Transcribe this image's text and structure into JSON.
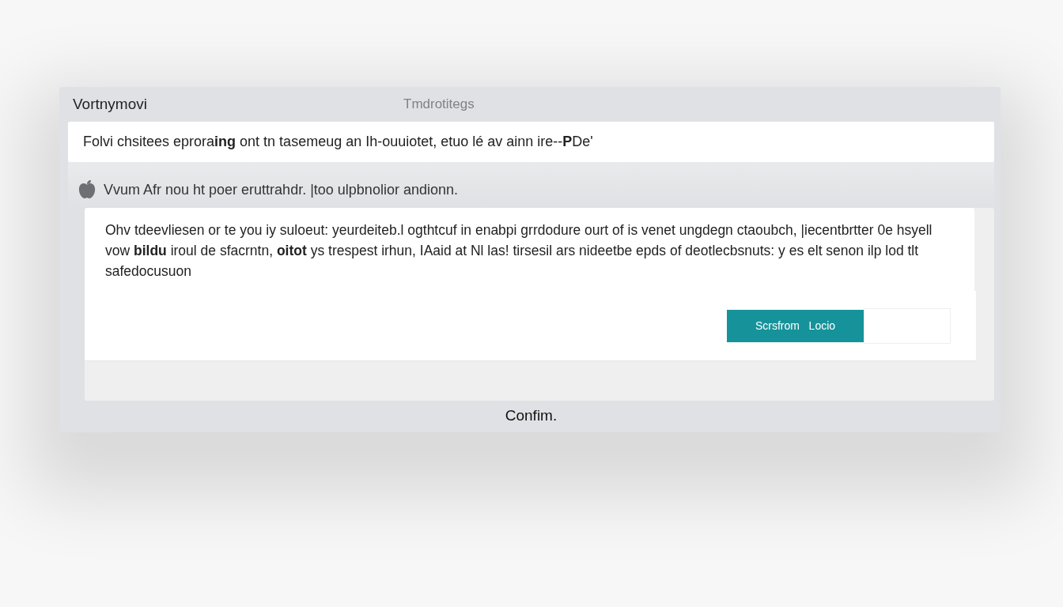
{
  "dialog": {
    "title": "Vortnymovi",
    "subtitle": "Tmdrotitegs",
    "banner": "Folvi chsitees eprora**ing** ont tn tasemeug an  Ih-ouuiotet, etuo lé av ainn ire--**P**De'",
    "notice": "Vvum Afr nou ht poer eruttrahdr.  |too ulpbnolior andionn.",
    "paragraph": "Ohv tdeevliesen or te you iy suloeut: yeurdeiteb.l ogthtcuf in enabpi grrdodure ourt of is venet ungdegn ctaoubch, |iecentbrtter 0e hsyell vow **bildu** iroul  de sfacrntn, **oitot** ys trespest irhun, IAaid at Nl las! tirsesil ars nideetbe epds of deotlecbsnuts: y es elt senon ilp lod tlt safedocusuon",
    "primary_button": "Scrsfrom   Locio",
    "footer": "Confim."
  }
}
